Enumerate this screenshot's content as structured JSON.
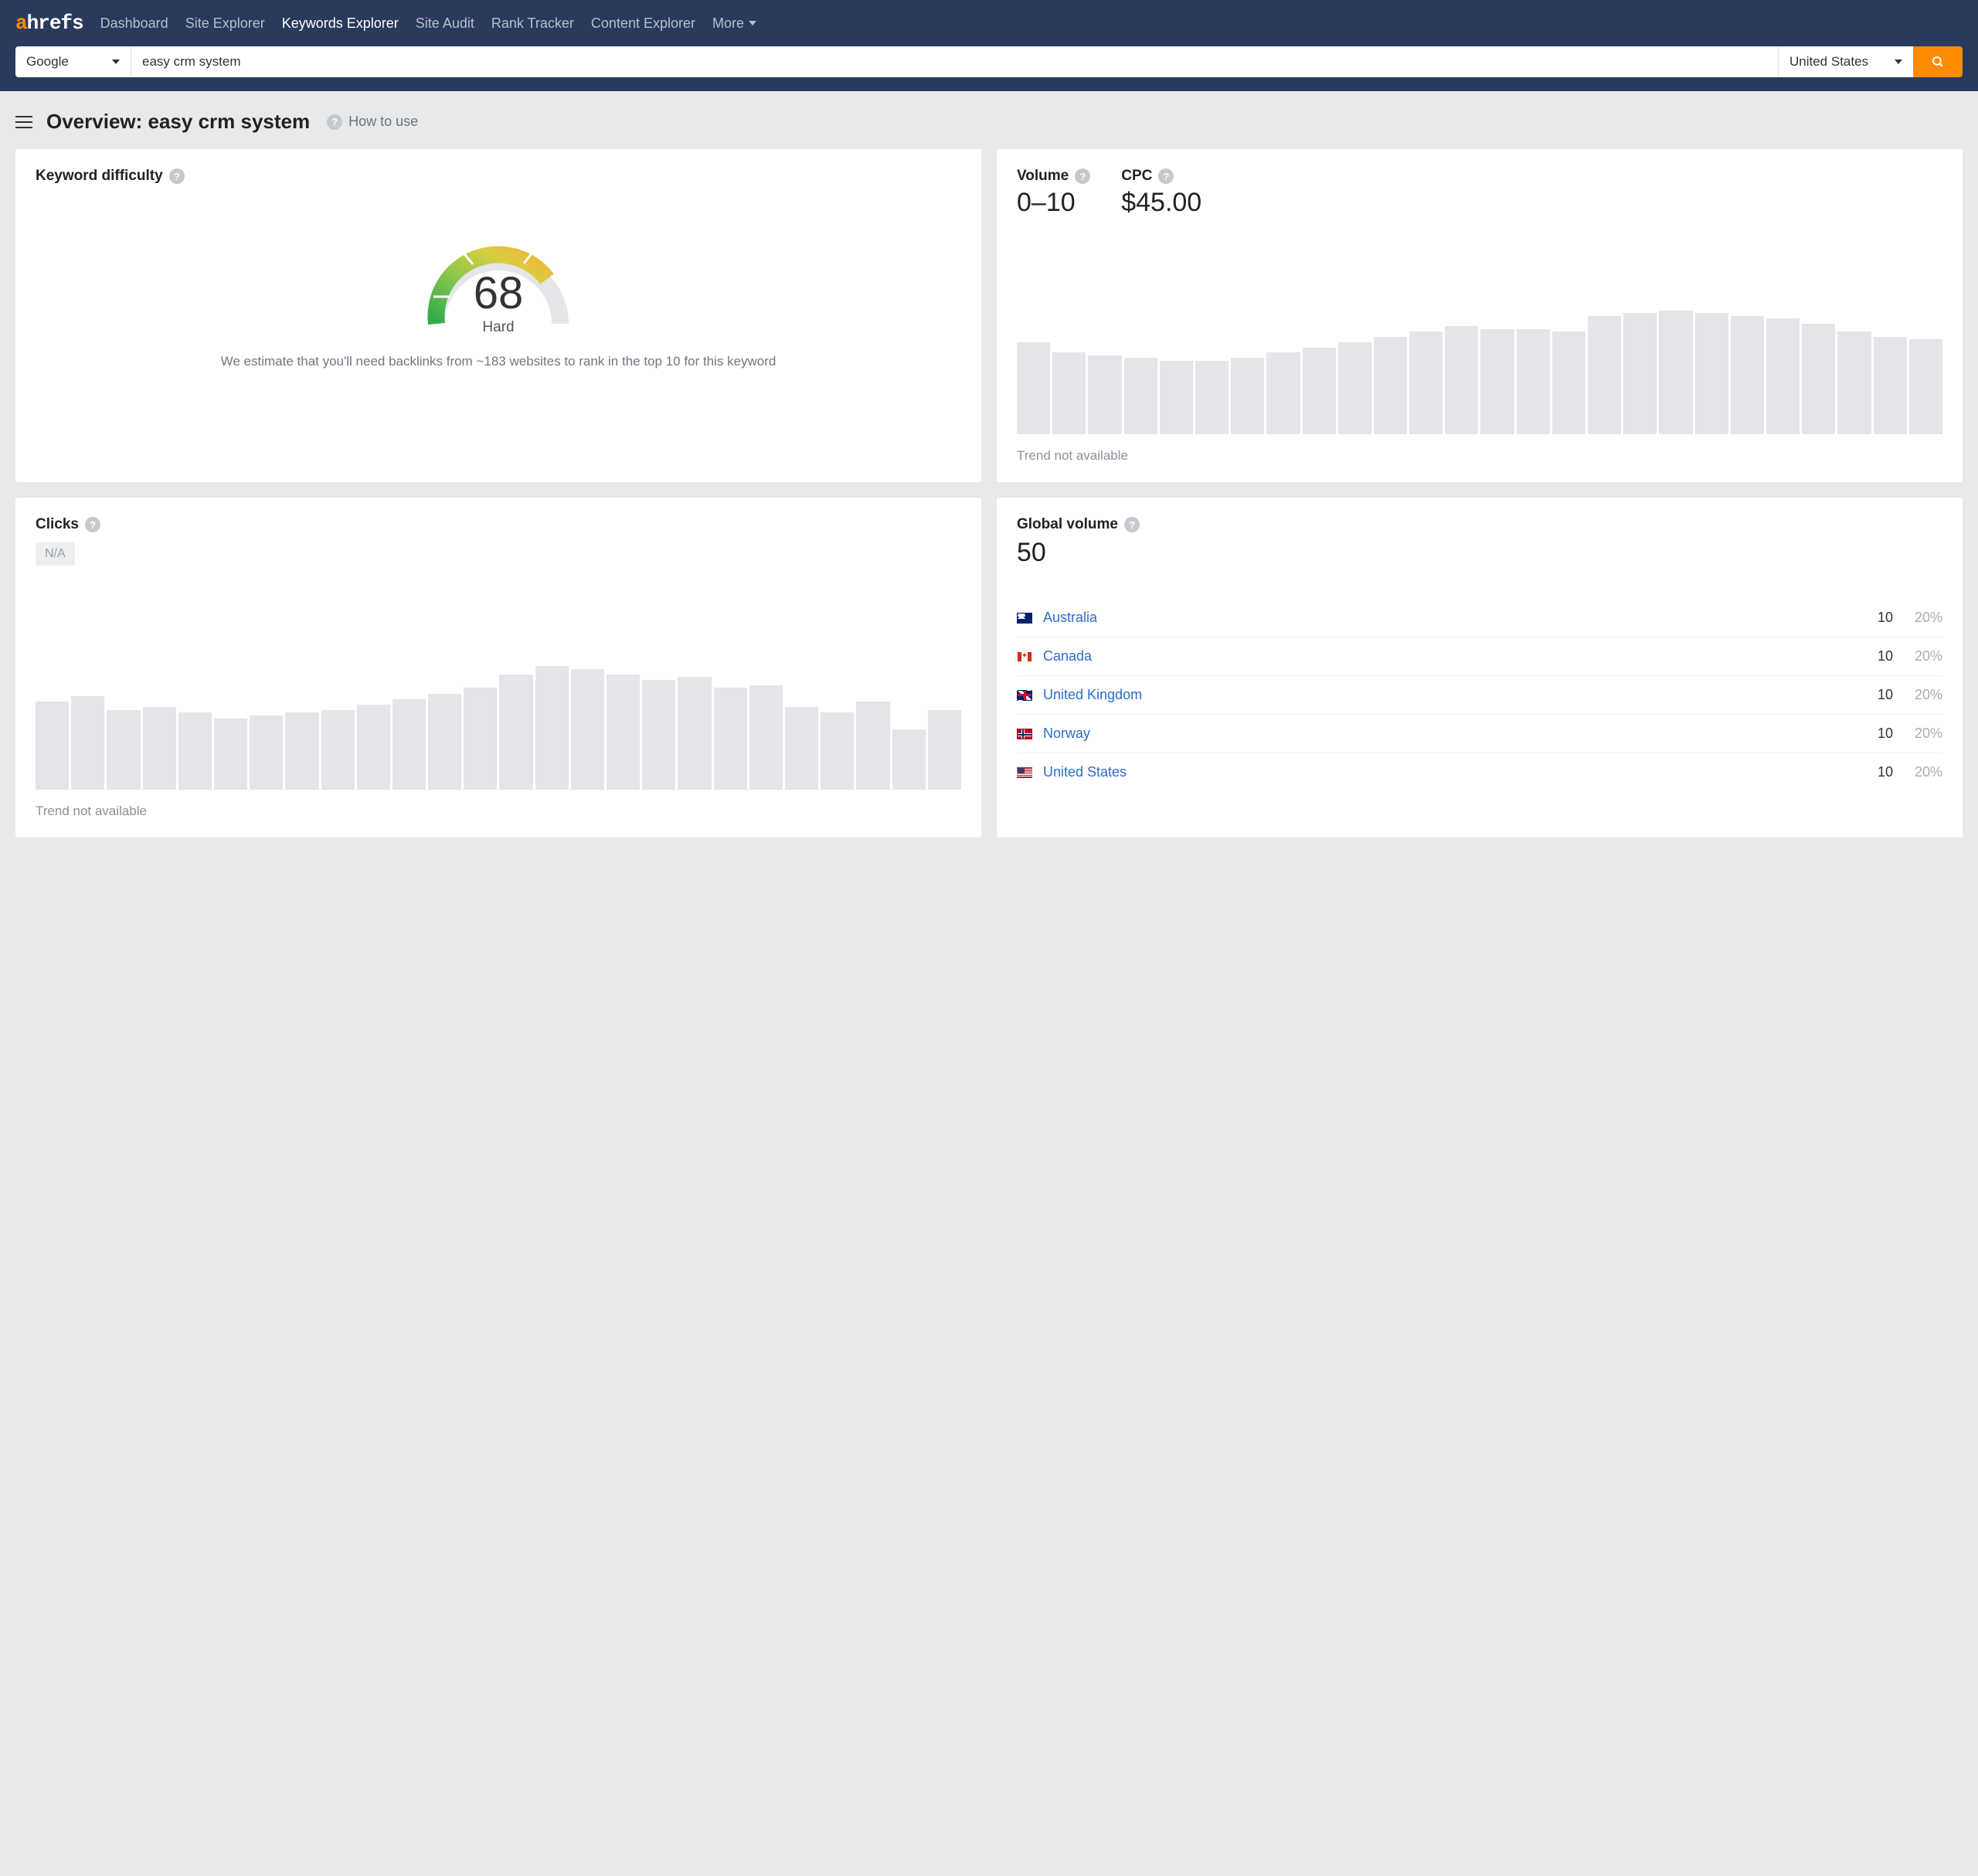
{
  "nav": {
    "items": [
      "Dashboard",
      "Site Explorer",
      "Keywords Explorer",
      "Site Audit",
      "Rank Tracker",
      "Content Explorer"
    ],
    "more": "More",
    "active_index": 2
  },
  "search": {
    "engine": "Google",
    "query": "easy crm system",
    "country": "United States"
  },
  "header": {
    "title": "Overview: easy crm system",
    "howto": "How to use"
  },
  "difficulty": {
    "label": "Keyword difficulty",
    "value": 68,
    "rating": "Hard",
    "note": "We estimate that you'll need backlinks from ~183 websites to rank in the top 10 for this keyword"
  },
  "volume": {
    "label": "Volume",
    "value": "0–10"
  },
  "cpc": {
    "label": "CPC",
    "value": "$45.00"
  },
  "trend_na": "Trend not available",
  "clicks": {
    "label": "Clicks",
    "na": "N/A"
  },
  "global": {
    "label": "Global volume",
    "value": "50",
    "rows": [
      {
        "country": "Australia",
        "flag": "au",
        "vol": "10",
        "pct": "20%"
      },
      {
        "country": "Canada",
        "flag": "ca",
        "vol": "10",
        "pct": "20%"
      },
      {
        "country": "United Kingdom",
        "flag": "gb",
        "vol": "10",
        "pct": "20%"
      },
      {
        "country": "Norway",
        "flag": "no",
        "vol": "10",
        "pct": "20%"
      },
      {
        "country": "United States",
        "flag": "us",
        "vol": "10",
        "pct": "20%"
      }
    ]
  },
  "chart_data": [
    {
      "type": "bar",
      "title": "Volume trend (relative, unlabeled)",
      "note": "Trend not available",
      "values": [
        70,
        62,
        60,
        58,
        56,
        56,
        58,
        62,
        66,
        70,
        74,
        78,
        82,
        80,
        80,
        78,
        90,
        92,
        94,
        92,
        90,
        88,
        84,
        78,
        74,
        72
      ]
    },
    {
      "type": "bar",
      "title": "Clicks trend (relative, unlabeled)",
      "note": "Trend not available",
      "values": [
        64,
        68,
        58,
        60,
        56,
        52,
        54,
        56,
        58,
        62,
        66,
        70,
        74,
        84,
        90,
        88,
        84,
        80,
        82,
        74,
        76,
        60,
        56,
        64,
        44,
        58
      ]
    }
  ]
}
